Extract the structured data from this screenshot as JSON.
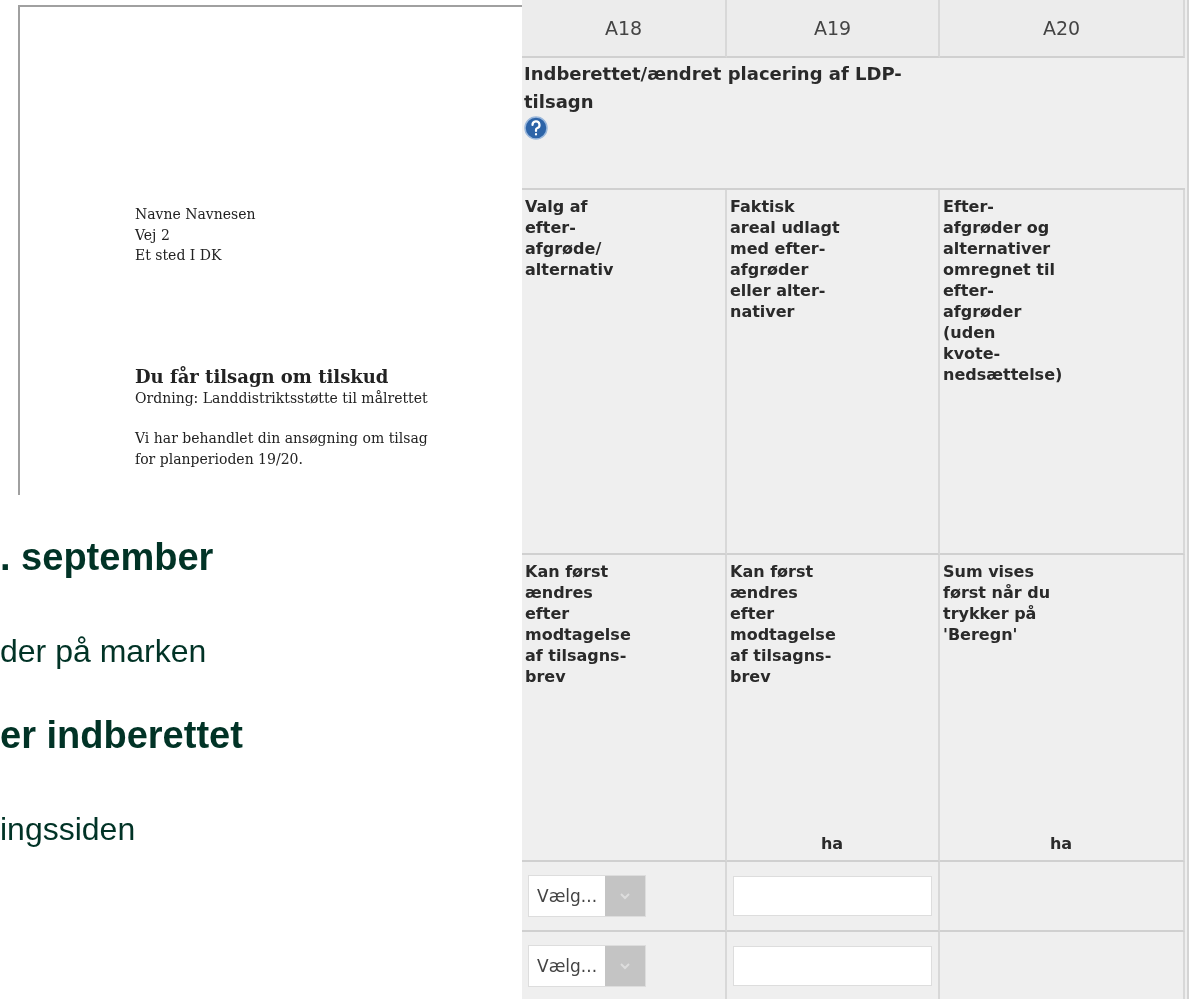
{
  "letter": {
    "recipient_lines": [
      "Navne Navnesen",
      "Vej 2",
      "Et sted I DK"
    ],
    "heading": "Du får tilsagn om tilskud",
    "scheme": "Ordning: Landdistriktsstøtte til målrettet",
    "body_lines": [
      "Vi har behandlet din ansøgning om tilsag",
      "for planperioden 19/20."
    ]
  },
  "slide_text": [
    {
      "kind": "heading",
      "text": ". september"
    },
    {
      "kind": "body",
      "text": "der på marken"
    },
    {
      "kind": "heading",
      "text": "er indberettet"
    },
    {
      "kind": "body",
      "text": "ingssiden"
    }
  ],
  "table": {
    "group_header": "Indberettet/ændret placering af LDP-\ntilsagn",
    "columns": [
      {
        "code": "A18",
        "description": "Valg af\nefter-\nafgrøde/\nalternativ",
        "note": "Kan først\nændres\nefter\nmodtagelse\naf tilsagns-\nbrev"
      },
      {
        "code": "A19",
        "description": "Faktisk\nareal udlagt\nmed efter-\nafgrøder\neller alter-\nnativer",
        "note": "Kan først\nændres\nefter\nmodtagelse\naf tilsagns-\nbrev",
        "unit": "ha"
      },
      {
        "code": "A20",
        "description": "Efter-\nafgrøder og\nalternativer\nomregnet til\nefter-\nafgrøder\n(uden\nkvote-\nnedsættelse)",
        "note": "Sum vises\nførst når du\ntrykker på\n'Beregn'",
        "unit": "ha"
      }
    ],
    "rows": [
      {
        "choice": "Vælg..."
      },
      {
        "choice": "Vælg..."
      }
    ]
  }
}
